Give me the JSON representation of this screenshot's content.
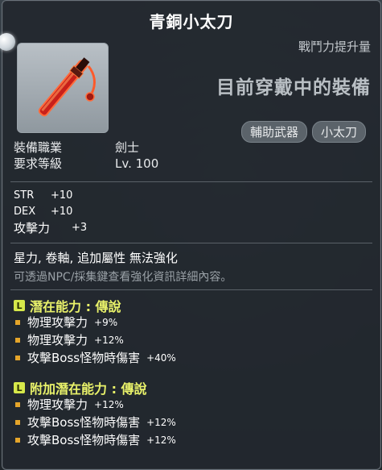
{
  "item": {
    "name": "青銅小太刀",
    "compare_label": "戰鬥力提升量",
    "equipped_label": "目前穿戴中的裝備",
    "tags": [
      "輔助武器",
      "小太刀"
    ]
  },
  "requirements": [
    {
      "label": "裝備職業",
      "value": "劍士"
    },
    {
      "label": "要求等級",
      "value": "Lv. 100"
    }
  ],
  "stats": [
    {
      "label": "STR",
      "value": "+10"
    },
    {
      "label": "DEX",
      "value": "+10"
    },
    {
      "label": "攻擊力",
      "value": "+3"
    }
  ],
  "flags_text": "星力, 卷軸, 追加屬性 無法強化",
  "hint_text": "可透過NPC/採集鍵查看強化資訊詳細內容。",
  "potential": {
    "grade_badge": "L",
    "header": "潛在能力 : 傳說",
    "lines": [
      {
        "label": "物理攻擊力",
        "value": "+9%"
      },
      {
        "label": "物理攻擊力",
        "value": "+12%"
      },
      {
        "label": "攻擊Boss怪物時傷害",
        "value": "+40%"
      }
    ]
  },
  "additional_potential": {
    "grade_badge": "L",
    "header": "附加潛在能力 : 傳說",
    "lines": [
      {
        "label": "物理攻擊力",
        "value": "+12%"
      },
      {
        "label": "攻擊Boss怪物時傷害",
        "value": "+12%"
      },
      {
        "label": "攻擊Boss怪物時傷害",
        "value": "+12%"
      }
    ]
  },
  "colors": {
    "legendary": "#e9f26a",
    "bullet": "#e5a52a",
    "panel": "#22282e"
  },
  "icons": {
    "item_icon": "katana-icon",
    "corner": "orb-icon"
  }
}
